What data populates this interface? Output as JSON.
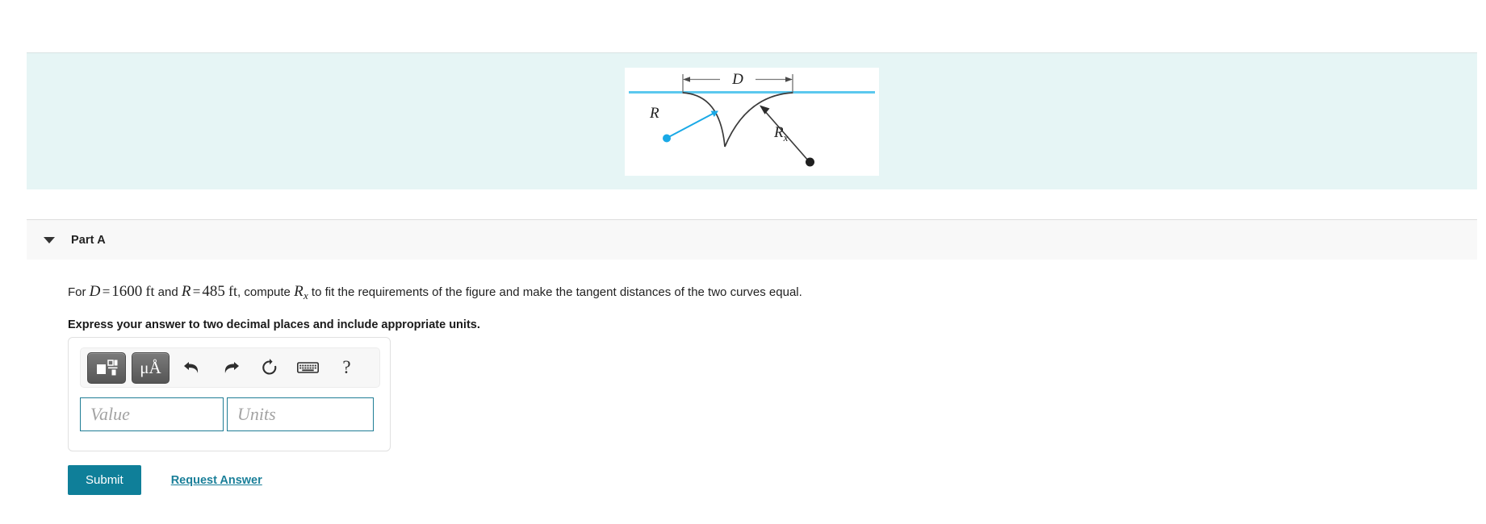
{
  "figure": {
    "alt_name": "reverse-curve-diagram",
    "labels": {
      "distance": "D",
      "radius_left": "R",
      "radius_right": "R",
      "radius_right_sub": "x"
    },
    "colors": {
      "tangent_line": "#5bc8ee",
      "radius_arrow": "#1aa9e6",
      "curve": "#3a3a3a",
      "panel_background": "#e6f5f5",
      "figure_background": "#ffffff"
    }
  },
  "part": {
    "title": "Part A",
    "collapse_icon": "caret-down-icon"
  },
  "question": {
    "lead": "For",
    "var_d": "D",
    "eq1": "=",
    "val_d": "1600",
    "unit_d": "ft",
    "conj": "and",
    "var_r": "R",
    "eq2": "=",
    "val_r": "485",
    "unit_r": "ft",
    "mid": ", compute",
    "var_rx": "R",
    "var_rx_sub": "x",
    "tail": "to fit the requirements of the figure and make the tangent distances of the two curves equal.",
    "instruction": "Express your answer to two decimal places and include appropriate units."
  },
  "toolbar": {
    "template_button_label": "template-icon",
    "units_button_label": "μÅ",
    "undo_label": "undo-icon",
    "redo_label": "redo-icon",
    "reset_label": "reset-icon",
    "keyboard_label": "keyboard-icon",
    "help_label": "?"
  },
  "answer": {
    "value": "",
    "value_placeholder": "Value",
    "units": "",
    "units_placeholder": "Units"
  },
  "actions": {
    "submit_label": "Submit",
    "request_answer_label": "Request Answer"
  },
  "colors": {
    "accent": "#0f7f99",
    "input_border": "#1f7d95",
    "banner": "#e6f5f5",
    "part_band": "#f8f8f8"
  }
}
